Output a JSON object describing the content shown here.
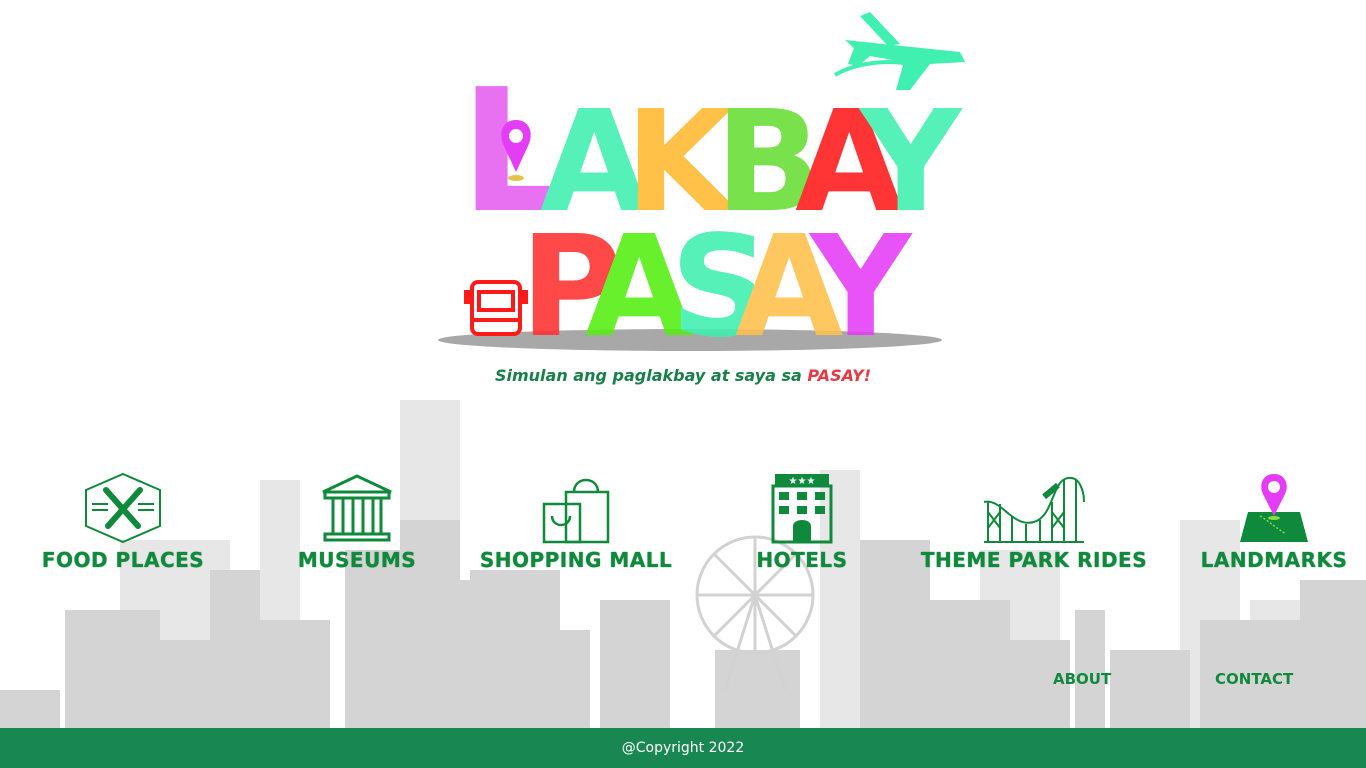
{
  "brand": {
    "logo_line1": "LAKBAY",
    "logo_line2": "PASAY",
    "tagline_main": "Simulan ang paglakbay at saya sa ",
    "tagline_accent": "PASAY!",
    "colors": {
      "green": "#0f8a3c",
      "footer": "#198752",
      "accent_red": "#e63946",
      "pink": "#e55ef0",
      "mint": "#3ff0b0"
    }
  },
  "nav": {
    "items": [
      {
        "label": "FOOD PLACES",
        "icon": "fork-knife-icon"
      },
      {
        "label": "MUSEUMS",
        "icon": "museum-icon"
      },
      {
        "label": "SHOPPING MALL",
        "icon": "shopping-bag-icon"
      },
      {
        "label": "HOTELS",
        "icon": "hotel-icon"
      },
      {
        "label": "THEME PARK RIDES",
        "icon": "roller-coaster-icon"
      },
      {
        "label": "LANDMARKS",
        "icon": "map-pin-icon"
      }
    ]
  },
  "links": {
    "about": "ABOUT",
    "contact": "CONTACT"
  },
  "footer": {
    "copyright": "@Copyright 2022"
  }
}
